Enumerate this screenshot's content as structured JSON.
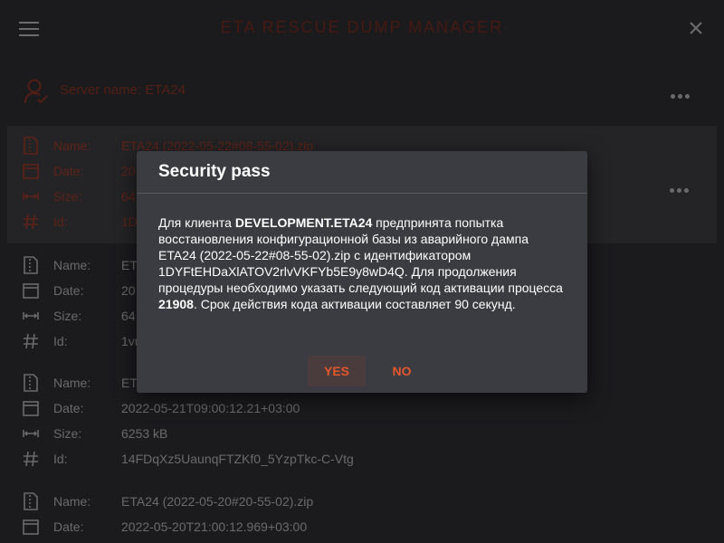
{
  "app": {
    "title": "ETA RESCUE DUMP MANAGER"
  },
  "server": {
    "label": "Server name: ETA24"
  },
  "field_labels": {
    "name": "Name:",
    "date": "Date:",
    "size": "Size:",
    "id": "Id:"
  },
  "dumps": [
    {
      "name": "ETA24 (2022-05-22#08-55-02).zip",
      "date": "20",
      "size": "64",
      "id": "1D",
      "selected": true
    },
    {
      "name": "ET",
      "date": "20",
      "size": "64",
      "id": "1vu"
    },
    {
      "name": "ET",
      "date": "2022-05-21T09:00:12.21+03:00",
      "size": "6253 kB",
      "id": "14FDqXz5UaunqFTZKf0_5YzpTkc-C-Vtg"
    },
    {
      "name": "ETA24 (2022-05-20#20-55-02).zip",
      "date": "2022-05-20T21:00:12.969+03:00"
    }
  ],
  "dialog": {
    "title": "Security pass",
    "p1": "Для клиента ",
    "client": "DEVELOPMENT.ETA24",
    "p2": " предпринята попытка восстановления конфигурационной базы из аварийного дампа ETA24 (2022-05-22#08-55-02).zip с идентификатором 1DYFtEHDaXlATOV2rlvVKFYb5E9y8wD4Q. Для продолжения процедуры необходимо указать следующий код активации процесса ",
    "code": "21908",
    "p3": ". Срок действия кода активации составляет 90 секунд.",
    "yes": "YES",
    "no": "NO"
  },
  "colors": {
    "accent": "#e2562c",
    "background": "#212124",
    "dialog": "#3b3c41"
  }
}
